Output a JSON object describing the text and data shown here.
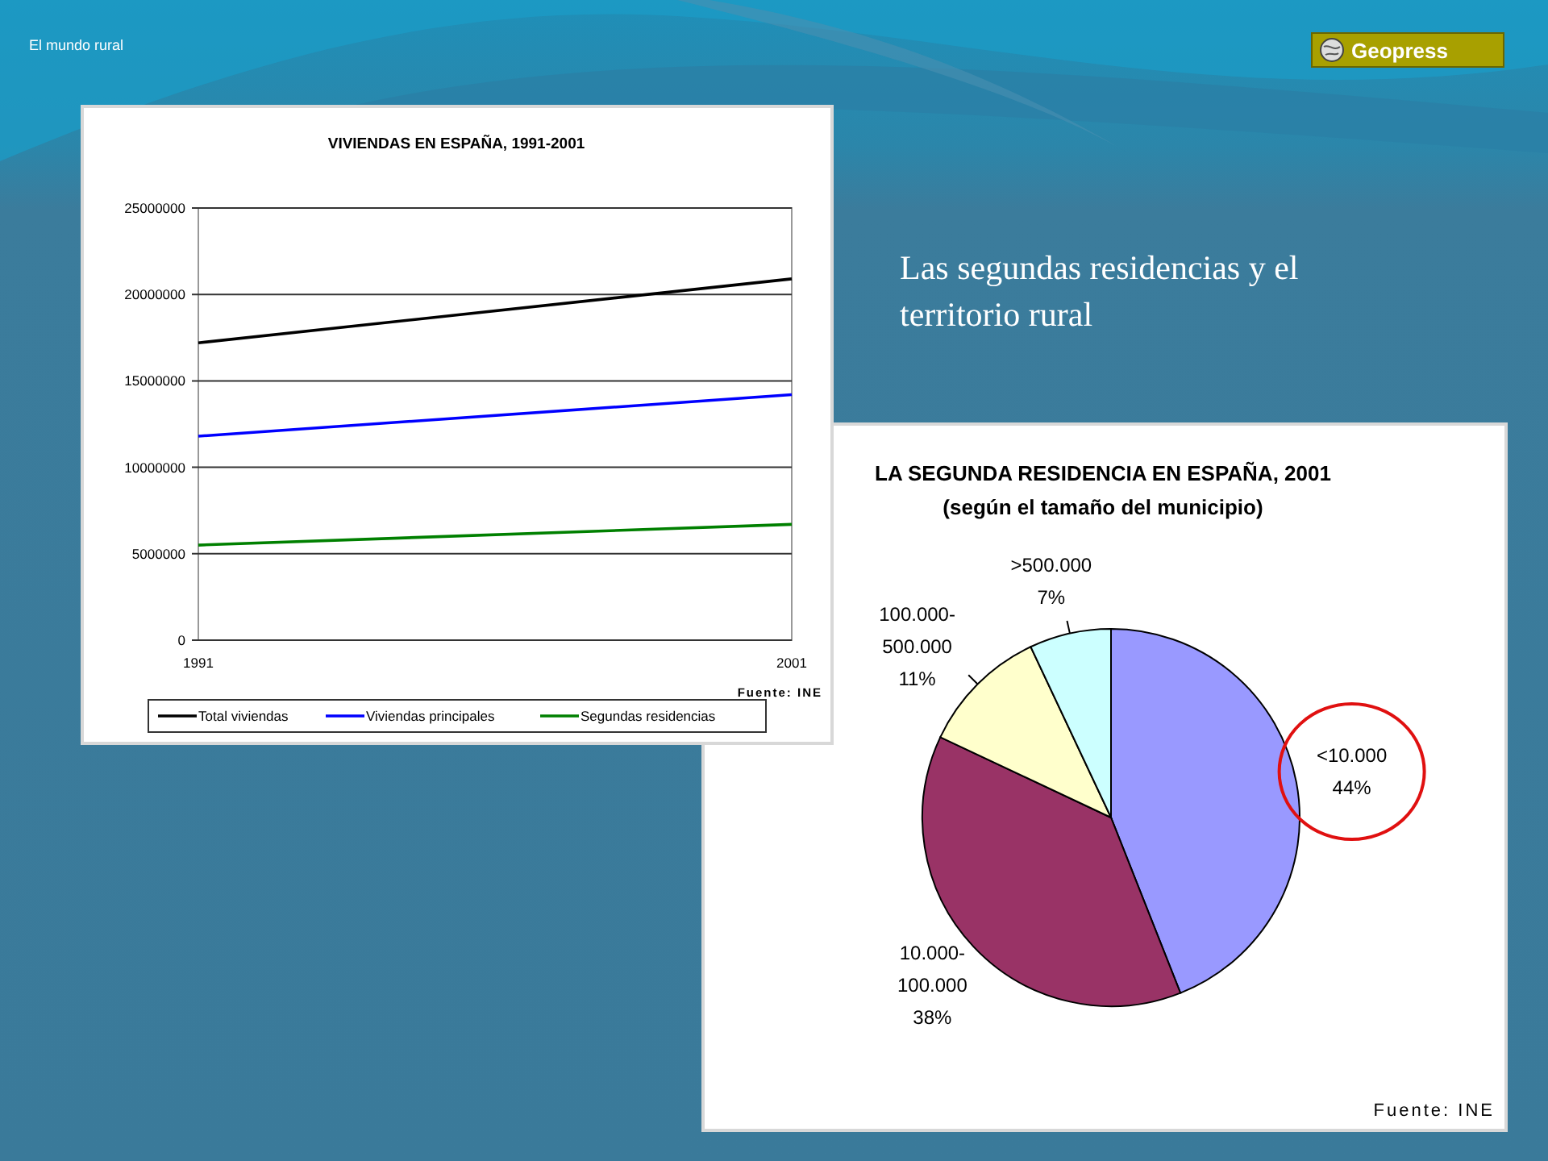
{
  "slide": {
    "header": "El mundo rural",
    "logo": {
      "name": "Geopress"
    },
    "heading": "Las segundas residencias y el territorio rural"
  },
  "line_panel": {
    "source": "Fuente: INE",
    "chart_data": {
      "type": "line",
      "title": "VIVIENDAS EN ESPAÑA, 1991-2001",
      "x": [
        1991,
        2001
      ],
      "xlim": [
        1991,
        2001
      ],
      "grid": true,
      "legend": true,
      "xticks": [
        {
          "value": 1991,
          "label": "1991"
        },
        {
          "value": 2001,
          "label": "2001"
        }
      ],
      "ylim": [
        0,
        25000000
      ],
      "yticks": [
        {
          "value": 0,
          "label": "0"
        },
        {
          "value": 5000000,
          "label": "5000000"
        },
        {
          "value": 10000000,
          "label": "10000000"
        },
        {
          "value": 15000000,
          "label": "15000000"
        },
        {
          "value": 20000000,
          "label": "20000000"
        },
        {
          "value": 25000000,
          "label": "25000000"
        }
      ],
      "series": [
        {
          "name": "Total viviendas",
          "color": "#000000",
          "values": [
            17200000,
            20900000
          ]
        },
        {
          "name": "Viviendas principales",
          "color": "#0000ff",
          "values": [
            11800000,
            14200000
          ]
        },
        {
          "name": "Segundas residencias",
          "color": "#008000",
          "values": [
            5500000,
            6700000
          ]
        }
      ]
    }
  },
  "pie_panel": {
    "subtitle": "(según el tamaño del municipio)",
    "source": "Fuente: INE",
    "slices": [
      {
        "highlighted": true
      },
      {
        "highlighted": false
      },
      {
        "highlighted": false
      },
      {
        "highlighted": false
      }
    ],
    "chart_data": {
      "type": "pie",
      "title": "LA SEGUNDA RESIDENCIA EN ESPAÑA, 2001",
      "categories": [
        "<10.000",
        "10.000-100.000",
        "100.000-500.000",
        ">500.000"
      ],
      "value_labels": [
        "44%",
        "38%",
        "11%",
        "7%"
      ],
      "series": [
        {
          "values": [
            44,
            38,
            11,
            7
          ]
        }
      ],
      "colors": [
        "#9999ff",
        "#993366",
        "#ffffcc",
        "#ccffff"
      ]
    }
  }
}
